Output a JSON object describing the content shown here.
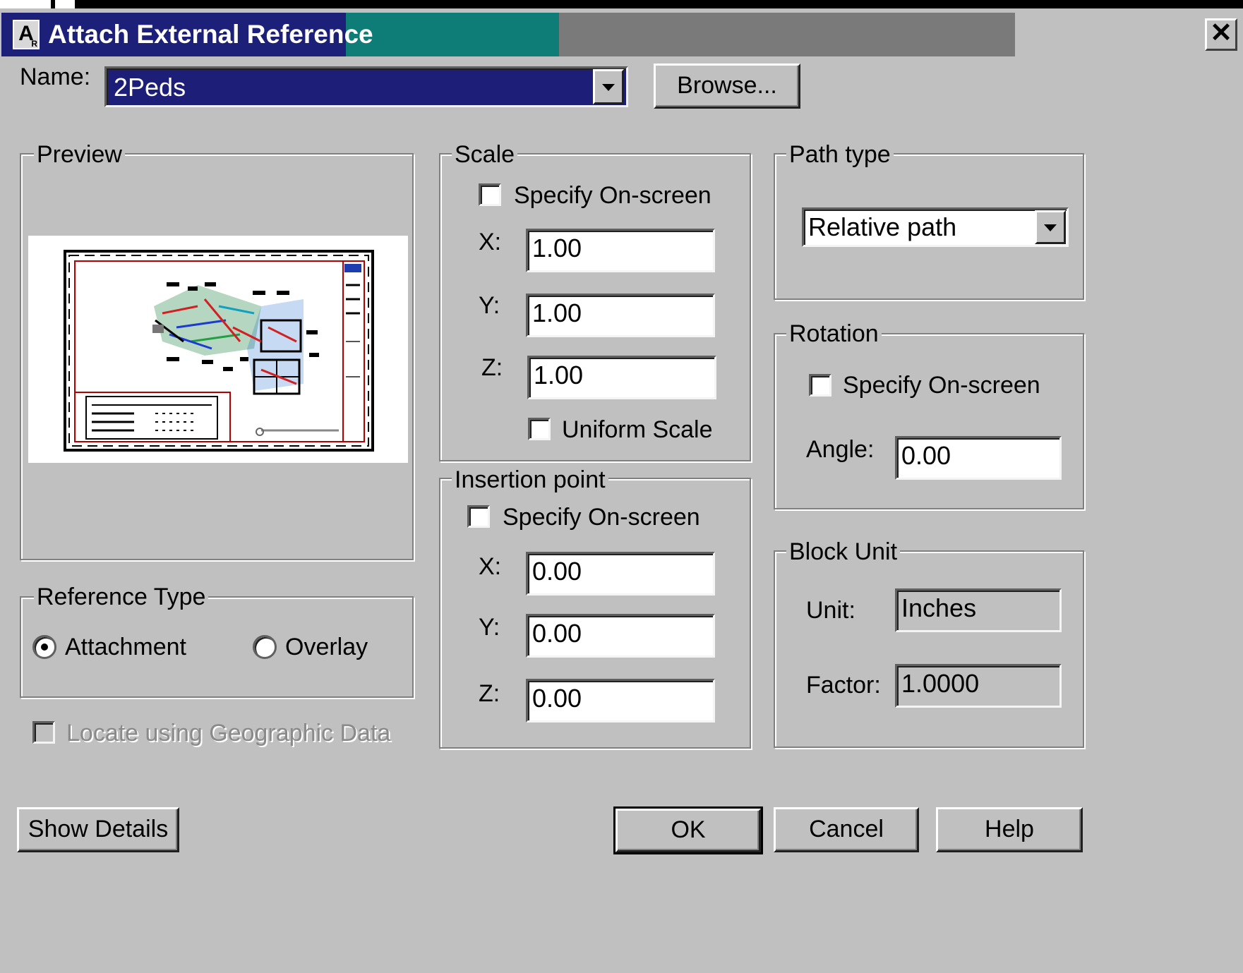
{
  "title_bar": {
    "title": "Attach External Reference",
    "close_glyph": "✕"
  },
  "name_row": {
    "label": "Name:",
    "value": "2Peds",
    "browse_label": "Browse..."
  },
  "preview": {
    "title": "Preview"
  },
  "scale": {
    "title": "Scale",
    "specify_label": "Specify On-screen",
    "x_label": "X:",
    "x_value": "1.00",
    "y_label": "Y:",
    "y_value": "1.00",
    "z_label": "Z:",
    "z_value": "1.00",
    "uniform_label": "Uniform Scale"
  },
  "path_type": {
    "title": "Path type",
    "value": "Relative path"
  },
  "rotation": {
    "title": "Rotation",
    "specify_label": "Specify On-screen",
    "angle_label": "Angle:",
    "angle_value": "0.00"
  },
  "insertion": {
    "title": "Insertion point",
    "specify_label": "Specify On-screen",
    "x_label": "X:",
    "x_value": "0.00",
    "y_label": "Y:",
    "y_value": "0.00",
    "z_label": "Z:",
    "z_value": "0.00"
  },
  "block_unit": {
    "title": "Block Unit",
    "unit_label": "Unit:",
    "unit_value": "Inches",
    "factor_label": "Factor:",
    "factor_value": "1.0000"
  },
  "reference_type": {
    "title": "Reference Type",
    "attachment_label": "Attachment",
    "overlay_label": "Overlay",
    "selected": "Attachment"
  },
  "geo_checkbox": {
    "label": "Locate using Geographic Data"
  },
  "buttons": {
    "show_details": "Show Details",
    "ok": "OK",
    "cancel": "Cancel",
    "help": "Help"
  },
  "colors": {
    "title_active": "#1c2078",
    "title_teal": "#0e7d78",
    "title_inactive": "#7a7a7a",
    "dialog_bg": "#c0c0c0",
    "name_field": "#1c1e78"
  }
}
